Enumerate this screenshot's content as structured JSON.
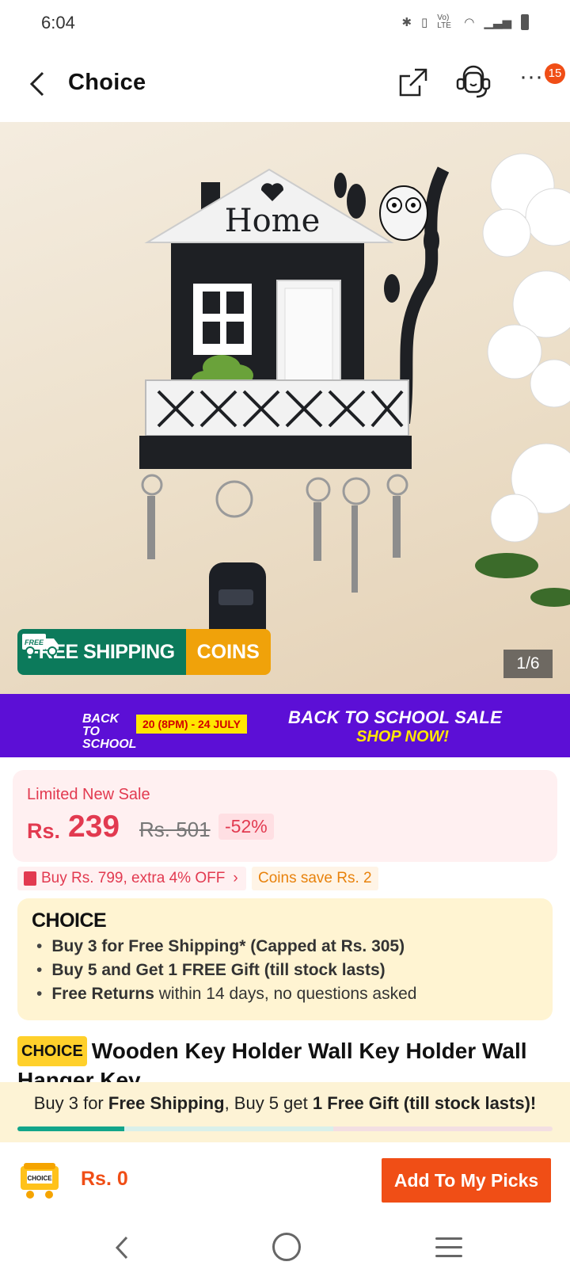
{
  "status_bar": {
    "time": "6:04",
    "icons": [
      "bluetooth-icon",
      "vibrate-icon",
      "volte-icon",
      "wifi-icon",
      "signal-icon",
      "battery-icon"
    ],
    "volte_label": "Vo) LTE"
  },
  "header": {
    "title": "Choice",
    "badge_count": "15"
  },
  "hero": {
    "counter": "1/6",
    "image_text": "Home",
    "free_badge": "FREE",
    "free_shipping": "FREE SHIPPING",
    "coins": "COINS"
  },
  "promo": {
    "logo": "BACK TO SCHOOL",
    "date": "20 (8PM) - 24 JULY",
    "title": "BACK TO SCHOOL SALE",
    "cta": "SHOP NOW!"
  },
  "price": {
    "label": "Limited New Sale",
    "currency": "Rs.",
    "value": "239",
    "original": "Rs. 501",
    "discount": "-52%"
  },
  "offers": {
    "coupon": "Buy Rs. 799, extra 4% OFF",
    "coins": "Coins save Rs. 2"
  },
  "choice": {
    "logo": "CHOICE",
    "bullet1": "Buy 3 for  Free Shipping* (Capped at Rs. 305)",
    "bullet2": "Buy 5 and Get 1 FREE Gift (till stock lasts)",
    "bullet3_bold": "Free Returns",
    "bullet3_rest": " within 14 days, no questions asked"
  },
  "product": {
    "tag": "CHOICE",
    "title": "Wooden Key Holder Wall Key Holder Wall Hanger Key"
  },
  "strip": {
    "p1": "Buy 3 for ",
    "b1": "Free Shipping",
    "p2": ", Buy 5 get ",
    "b2": "1 Free Gift (till stock lasts)!",
    "progress": 0.2
  },
  "bottom": {
    "cart_label": "CHOICE",
    "total": "Rs. 0",
    "add_button": "Add To My Picks"
  },
  "colors": {
    "accent": "#f04e16",
    "choice_yellow": "#ffd02b",
    "banner_purple": "#5c0fd6",
    "ship_green": "#0c7a5b",
    "coins_orange": "#f0a20a",
    "price_red": "#e23a50"
  }
}
